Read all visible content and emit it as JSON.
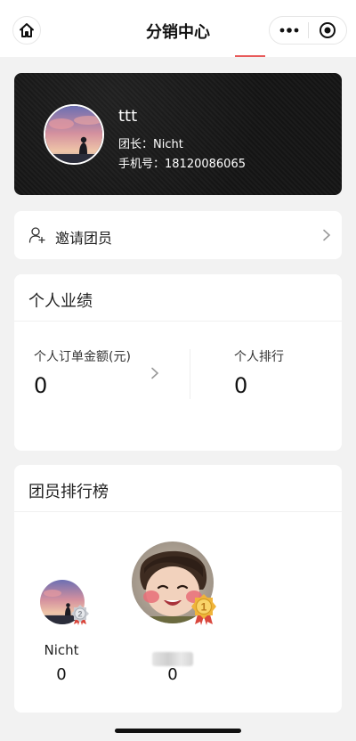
{
  "navbar": {
    "title": "分销中心",
    "home_icon": "home-icon",
    "more_icon": "more-dots-icon",
    "close_icon": "target-circle-icon",
    "accent": "#e85a5a"
  },
  "profile": {
    "name": "ttt",
    "leader": "团长：Nicht",
    "phone": "手机号：18120086065"
  },
  "invite": {
    "label": "邀请团员",
    "icon": "add-user-icon"
  },
  "performance": {
    "title": "个人业绩",
    "order_amount_label": "个人订单金额(元)",
    "order_amount_value": "0",
    "rank_label": "个人排行",
    "rank_value": "0"
  },
  "leaderboard": {
    "title": "团员排行榜",
    "entries": [
      {
        "rank_badge": "2",
        "name": "Nicht",
        "score": "0"
      },
      {
        "rank_badge": "1",
        "name": "",
        "score": "0"
      }
    ]
  }
}
